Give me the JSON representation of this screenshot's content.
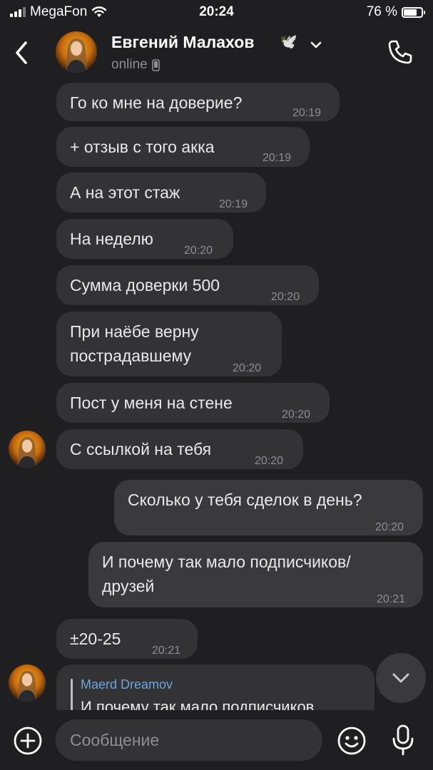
{
  "status_bar": {
    "carrier": "MegaFon",
    "time": "20:24",
    "battery": "76 %",
    "battery_level": 0.76
  },
  "header": {
    "contact_name": "Евгений Малахов",
    "name_emoji": "🕊️",
    "status": "online"
  },
  "messages": [
    {
      "text": "Го ко мне на доверие?",
      "time": "20:19",
      "direction": "in"
    },
    {
      "text": "+ отзыв с того акка",
      "time": "20:19",
      "direction": "in"
    },
    {
      "text": "А на этот стаж",
      "time": "20:19",
      "direction": "in"
    },
    {
      "text": "На неделю",
      "time": "20:20",
      "direction": "in"
    },
    {
      "text": "Сумма доверки 500",
      "time": "20:20",
      "direction": "in"
    },
    {
      "text": "При наёбе верну\nпострадавшему",
      "time": "20:20",
      "direction": "in"
    },
    {
      "text": "Пост у меня на стене",
      "time": "20:20",
      "direction": "in"
    },
    {
      "text": "С ссылкой на тебя",
      "time": "20:20",
      "direction": "in"
    },
    {
      "text": "Сколько у тебя сделок в день?",
      "time": "20:20",
      "direction": "out"
    },
    {
      "text": "И почему так мало подписчиков/\nдрузей",
      "time": "20:21",
      "direction": "out"
    },
    {
      "text": "±20-25",
      "time": "20:21",
      "direction": "in"
    }
  ],
  "reply": {
    "author": "Maerd Dreamov",
    "quoted_text": "И почему так мало подписчиков"
  },
  "composer": {
    "placeholder": "Сообщение"
  },
  "colors": {
    "background": "#1f1f21",
    "bubble": "#333335",
    "reply_author": "#6fa4e0"
  },
  "icons": [
    "back-chevron-icon",
    "chevron-down-icon",
    "phone-icon",
    "phone-device-icon",
    "plus-circle-icon",
    "emoji-icon",
    "microphone-icon",
    "scroll-down-chevron-icon"
  ]
}
